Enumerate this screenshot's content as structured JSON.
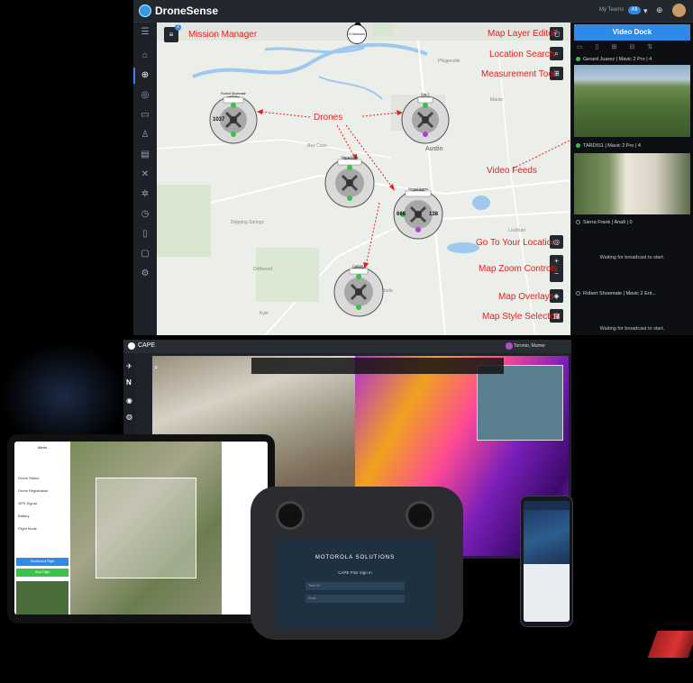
{
  "colors": {
    "accent": "#2e8ae6",
    "annotation": "#e51f1f",
    "dock_bg": "#0d0f12"
  },
  "app": {
    "title": "DroneSense",
    "team_label": "My Teams",
    "team_value": "All"
  },
  "sidebar": {
    "items": [
      {
        "icon": "menu-icon"
      },
      {
        "icon": "home-icon"
      },
      {
        "icon": "map-icon"
      },
      {
        "icon": "incident-icon"
      },
      {
        "icon": "card-icon"
      },
      {
        "icon": "people-icon"
      },
      {
        "icon": "logs-icon"
      },
      {
        "icon": "drone-icon"
      },
      {
        "icon": "fan-icon"
      },
      {
        "icon": "history-icon"
      },
      {
        "icon": "document-icon"
      },
      {
        "icon": "briefcase-icon"
      },
      {
        "icon": "settings-people-icon"
      }
    ]
  },
  "mission_manager": {
    "badge": "2"
  },
  "compass_label": "N Gestures",
  "annotations": {
    "mission_manager": "Mission Manager",
    "map_layer_editor": "Map Layer Editor",
    "location_search": "Location Search",
    "measurement_tool": "Measurement Tool",
    "drones": "Drones",
    "video_feeds": "Video Feeds",
    "go_to_location": "Go To Your Location",
    "map_zoom": "Map Zoom Controls",
    "map_overlays": "Map Overlays",
    "map_style": "Map Style Selector"
  },
  "map_labels": {
    "city": "Austin",
    "place1": "Bee Cave",
    "place2": "Dripping Springs",
    "place3": "Driftwood",
    "place4": "Kyle",
    "place5": "Lockhart",
    "place6": "Pflugerville",
    "place7": "Manor",
    "place8": "Buda"
  },
  "drones": [
    {
      "name": "Robert Shoemate",
      "left": "1037",
      "right": ""
    },
    {
      "name": "Eric T",
      "left": "",
      "right": ""
    },
    {
      "name": "Sierra Frank",
      "left": "",
      "right": ""
    },
    {
      "name": "Gerard Juarez",
      "left": "668",
      "right": "138"
    },
    {
      "name": "TARDIS1",
      "left": "",
      "right": ""
    }
  ],
  "dock": {
    "title": "Video Dock",
    "feeds": [
      {
        "label": "Gerard Juarez | Mavic 2 Pro | 4",
        "status": "#38c24a"
      },
      {
        "label": "TARDIS1 | Mavic 2 Pro | 4",
        "status": "#38c24a"
      },
      {
        "label": "Sierra Frank | Anafi | 0",
        "status": "#8a8f96"
      },
      {
        "label": "Robert Shoemate | Mavic 2 Ent...",
        "status": "#8a8f96"
      }
    ],
    "waiting": "Waiting for broadcast to start."
  },
  "cape": {
    "title": "CAPE",
    "user": "Toronto, Mumer"
  },
  "controller": {
    "brand": "MOTOROLA SOLUTIONS",
    "signin": "CAPE Pilot Sign In",
    "field1": "Team ID",
    "field2": "Email"
  },
  "tablet": {
    "panel_title": "Alerts",
    "items": [
      "Drone Status",
      "Drone Registration",
      "GPS Signal",
      "Battery",
      "Flight Mode"
    ],
    "btn1": "Geofenced Flight",
    "btn2": "Stop Flight"
  }
}
